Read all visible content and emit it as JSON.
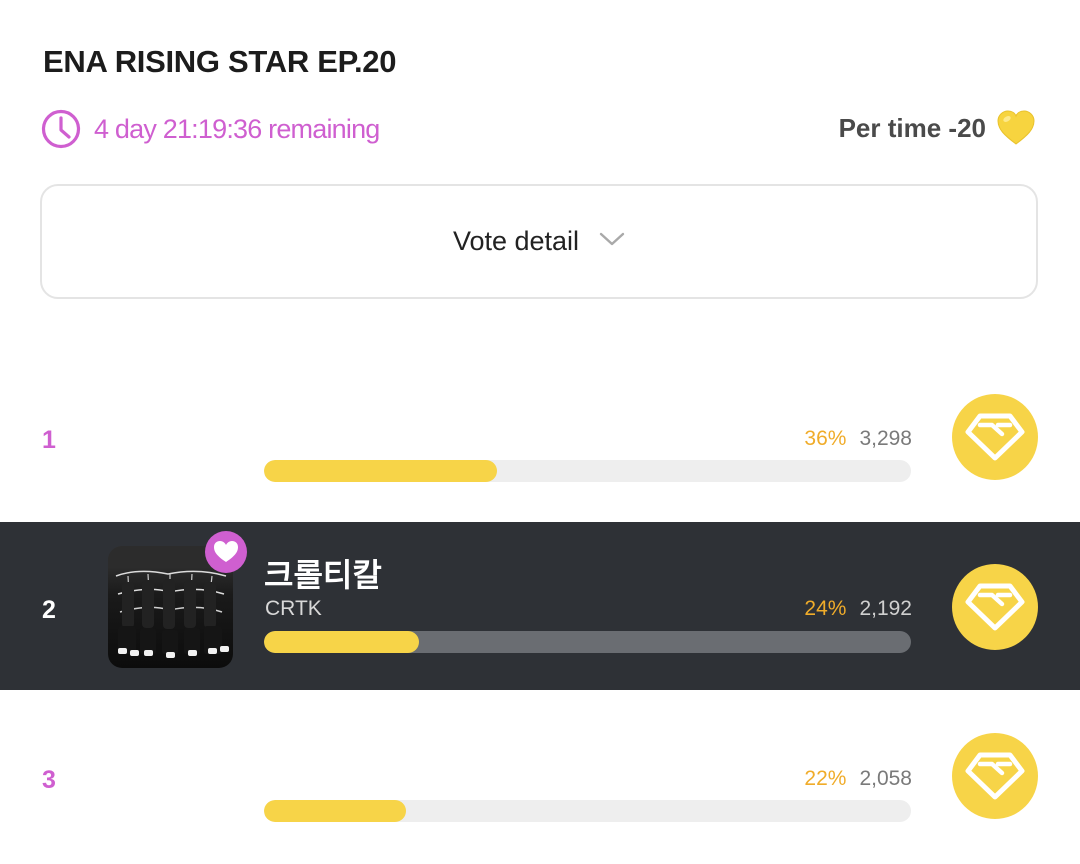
{
  "event": {
    "title": "ENA RISING STAR EP.20"
  },
  "timer": {
    "remaining": "4 day 21:19:36 remaining"
  },
  "cost": {
    "label": "Per time -20"
  },
  "vote_detail": {
    "label": "Vote detail"
  },
  "colors": {
    "accent": "#cf5fd0",
    "bar": "#f7d448",
    "percent": "#f0ac2a",
    "highlight_bg": "#2e3136"
  },
  "rankings": [
    {
      "rank": "1",
      "name": "",
      "sub": "",
      "percent": "36%",
      "votes": "3,298",
      "progress": 0.36,
      "highlighted": false
    },
    {
      "rank": "2",
      "name": "크롤티칼",
      "sub": "CRTK",
      "percent": "24%",
      "votes": "2,192",
      "progress": 0.24,
      "highlighted": true
    },
    {
      "rank": "3",
      "name": "",
      "sub": "",
      "percent": "22%",
      "votes": "2,058",
      "progress": 0.22,
      "highlighted": false
    }
  ]
}
